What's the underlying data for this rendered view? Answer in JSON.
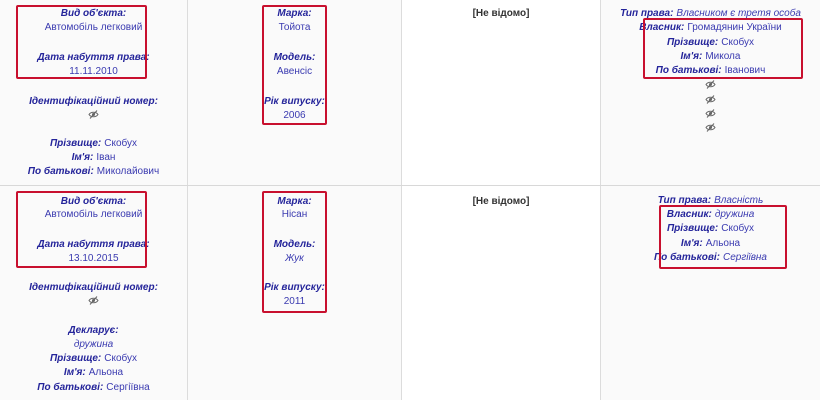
{
  "rows": [
    {
      "object": {
        "type_label": "Вид об'єкта:",
        "type_value": "Автомобіль легковий",
        "date_label": "Дата набуття права:",
        "date_value": "11.11.2010",
        "id_label": "Ідентифікаційний номер:",
        "surname_label": "Прізвище:",
        "surname_value": "Скобух",
        "name_label": "Ім'я:",
        "name_value": "Іван",
        "patronymic_label": "По батькові:",
        "patronymic_value": "Миколайович"
      },
      "vehicle": {
        "brand_label": "Марка:",
        "brand_value": "Тойота",
        "model_label": "Модель:",
        "model_value": "Авенсіс",
        "year_label": "Рік випуску:",
        "year_value": "2006"
      },
      "value_text": "[Не відомо]",
      "rights": {
        "type_label": "Тип права:",
        "type_value": "Власником є третя особа",
        "owner_label": "Власник:",
        "owner_value": "Громадянин України",
        "surname_label": "Прізвище:",
        "surname_value": "Скобух",
        "name_label": "Ім'я:",
        "name_value": "Микола",
        "patronymic_label": "По батькові:",
        "patronymic_value": "Іванович"
      }
    },
    {
      "object": {
        "type_label": "Вид об'єкта:",
        "type_value": "Автомобіль легковий",
        "date_label": "Дата набуття права:",
        "date_value": "13.10.2015",
        "id_label": "Ідентифікаційний номер:",
        "declarant_label": "Декларує:",
        "declarant_value": "дружина",
        "surname_label": "Прізвище:",
        "surname_value": "Скобух",
        "name_label": "Ім'я:",
        "name_value": "Альона",
        "patronymic_label": "По батькові:",
        "patronymic_value": "Сергіївна"
      },
      "vehicle": {
        "brand_label": "Марка:",
        "brand_value": "Нісан",
        "model_label": "Модель:",
        "model_value": "Жук",
        "year_label": "Рік випуску:",
        "year_value": "2011"
      },
      "value_text": "[Не відомо]",
      "rights": {
        "type_label": "Тип права:",
        "type_value": "Власність",
        "owner_label": "Власник:",
        "owner_value": "дружина",
        "surname_label": "Прізвище:",
        "surname_value": "Скобух",
        "name_label": "Ім'я:",
        "name_value": "Альона",
        "patronymic_label": "По батькові:",
        "patronymic_value": "Сергіївна"
      }
    }
  ],
  "icons": {
    "hidden_value": "eye-slash-icon"
  },
  "colors": {
    "label": "#24249a",
    "value": "#3a3ab0",
    "highlight": "#c8102e",
    "unknown": "#333333"
  }
}
